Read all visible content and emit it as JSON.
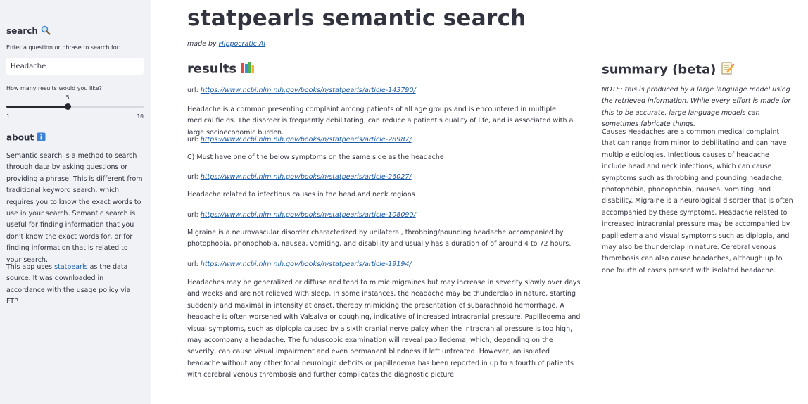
{
  "sidebar": {
    "search_heading": "search",
    "search_label": "Enter a question or phrase to search for:",
    "search_value": "Headache",
    "slider_label": "How many results would you like?",
    "slider_value": 5,
    "slider_min": "1",
    "slider_max": "10",
    "slider_fraction": 0.444,
    "about_heading": "about",
    "about_text": "Semantic search is a method to search through data by asking questions or providing a phrase. This is different from traditional keyword search, which requires you to know the exact words to use in your search. Semantic search is useful for finding information that you don't know the exact words for, or for finding information that is related to your search.",
    "app_text_pre": "This app uses",
    "app_link": "statpearls",
    "app_text_post": "as the data source. It was downloaded in accordance with the usage policy via FTP."
  },
  "main": {
    "title": "statpearls semantic search",
    "made_by_prefix": "made by",
    "made_by_link": "Hippocratic AI",
    "results_heading": "results",
    "url_label": "url:",
    "results": [
      {
        "url": "https://www.ncbi.nlm.nih.gov/books/n/statpearls/article-143790/",
        "text": "Headache is a common presenting complaint among patients of all age groups and is encountered in multiple medical fields. The disorder is frequently debilitating, can reduce a patient's quality of life, and is associated with a large socioeconomic burden."
      },
      {
        "url": "https://www.ncbi.nlm.nih.gov/books/n/statpearls/article-28987/",
        "text": "C) Must have one of the below symptoms on the same side as the headache"
      },
      {
        "url": "https://www.ncbi.nlm.nih.gov/books/n/statpearls/article-26027/",
        "text": "Headache related to infectious causes in the head and neck regions"
      },
      {
        "url": "https://www.ncbi.nlm.nih.gov/books/n/statpearls/article-108090/",
        "text": "Migraine is a neurovascular disorder characterized by unilateral, throbbing/pounding headache accompanied by photophobia, phonophobia, nausea, vomiting, and disability and usually has a duration of of around 4 to 72 hours."
      },
      {
        "url": "https://www.ncbi.nlm.nih.gov/books/n/statpearls/article-19194/",
        "text": "Headaches may be generalized or diffuse and tend to mimic migraines but may increase in severity slowly over days and weeks and are not relieved with sleep. In some instances, the headache may be thunderclap in nature, starting suddenly and maximal in intensity at onset, thereby mimicking the presentation of subarachnoid hemorrhage. A headache is often worsened with Valsalva or coughing, indicative of increased intracranial pressure. Papilledema and visual symptoms, such as diplopia caused by a sixth cranial nerve palsy when the intracranial pressure is too high, may accompany a headache. The funduscopic examination will reveal papilledema, which, depending on the severity, can cause visual impairment and even permanent blindness if left untreated. However, an isolated headache without any other focal neurologic deficits or papilledema has been reported in up to a fourth of patients with cerebral venous thrombosis and further complicates the diagnostic picture."
      }
    ]
  },
  "summary": {
    "heading": "summary (beta)",
    "note": "NOTE: this is produced by a large language model using the retrieved information. While every effort is made for this to be accurate, large language models can sometimes fabricate things.",
    "text": "Causes Headaches are a common medical complaint that can range from minor to debilitating and can have multiple etiologies. Infectious causes of headache include head and neck infections, which can cause symptoms such as throbbing and pounding headache, photophobia, phonophobia, nausea, vomiting, and disability. Migraine is a neurological disorder that is often accompanied by these symptoms. Headache related to increased intracranial pressure may be accompanied by papilledema and visual symptoms such as diplopia, and may also be thunderclap in nature. Cerebral venous thrombosis can also cause headaches, although up to one fourth of cases present with isolated headache."
  },
  "icons": {
    "search": "magnifier-icon",
    "about": "info-icon",
    "results": "books-icon",
    "summary": "memo-icon"
  },
  "colors": {
    "sidebar_bg": "#f0f2f6",
    "text": "#31333f",
    "link": "#1c5ca8",
    "slider": "#262730"
  }
}
